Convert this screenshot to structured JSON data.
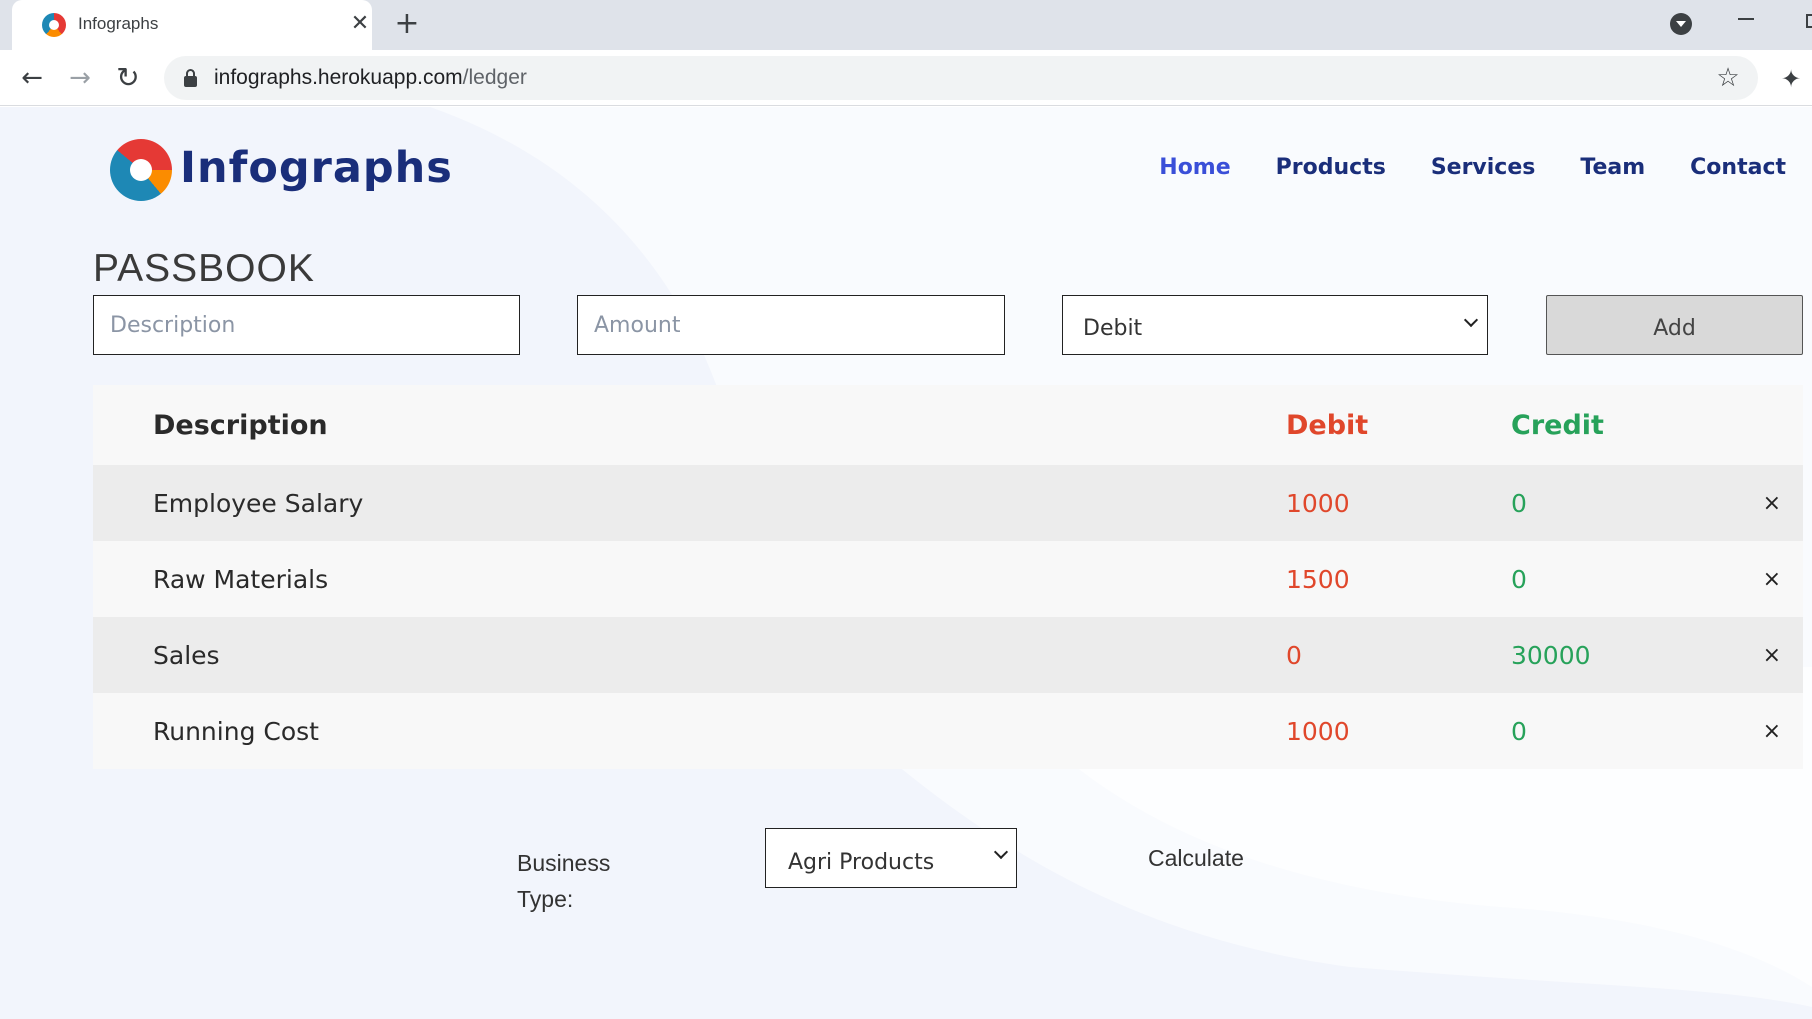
{
  "browser": {
    "tab_title": "Infographs",
    "url_host": "infographs.herokuapp.com",
    "url_path": "/ledger"
  },
  "site": {
    "brand": "Infographs",
    "nav": [
      {
        "label": "Home",
        "active": true
      },
      {
        "label": "Products",
        "active": false
      },
      {
        "label": "Services",
        "active": false
      },
      {
        "label": "Team",
        "active": false
      },
      {
        "label": "Contact",
        "active": false
      }
    ]
  },
  "passbook": {
    "title": "PASSBOOK",
    "description_placeholder": "Description",
    "amount_placeholder": "Amount",
    "type_selected": "Debit",
    "add_label": "Add"
  },
  "ledger": {
    "headers": {
      "description": "Description",
      "debit": "Debit",
      "credit": "Credit"
    },
    "rows": [
      {
        "description": "Employee Salary",
        "debit": "1000",
        "credit": "0"
      },
      {
        "description": "Raw Materials",
        "debit": "1500",
        "credit": "0"
      },
      {
        "description": "Sales",
        "debit": "0",
        "credit": "30000"
      },
      {
        "description": "Running Cost",
        "debit": "1000",
        "credit": "0"
      }
    ],
    "delete_glyph": "×"
  },
  "calc": {
    "label": "Business Type:",
    "selected": "Agri Products",
    "calculate_label": "Calculate"
  },
  "colors": {
    "brand": "#1a2e7a",
    "nav_active": "#3a4fd8",
    "debit": "#e0472b",
    "credit": "#27a25a",
    "page_bg": "#f2f5fc"
  }
}
